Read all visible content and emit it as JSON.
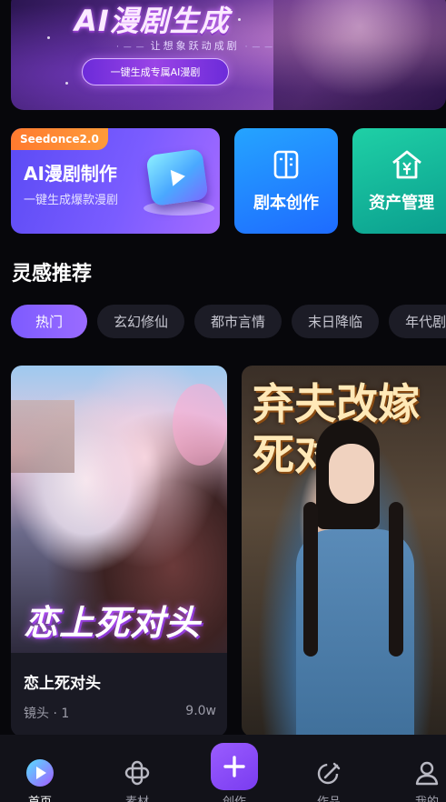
{
  "banner": {
    "title": "AI漫剧生成",
    "subtitle": "让想象跃动成剧",
    "cta_label": "一键生成专属AI漫剧"
  },
  "features": {
    "ai_card": {
      "tag": "Seedonce2.0",
      "title": "AI漫剧制作",
      "subtitle": "一键生成爆款漫剧",
      "icon": "play-icon"
    },
    "script_card": {
      "label": "剧本创作",
      "icon": "book-icon"
    },
    "assets_card": {
      "label": "资产管理",
      "icon": "house-yen-icon"
    }
  },
  "section": {
    "title": "灵感推荐"
  },
  "chips": [
    "热门",
    "玄幻修仙",
    "都市言情",
    "末日降临",
    "年代剧"
  ],
  "cards": [
    {
      "poster_title": "恋上死对头",
      "title": "恋上死对头",
      "meta": "镜头 · 1",
      "views": "9.0w"
    },
    {
      "poster_title_line1": "弃夫改嫁",
      "poster_title_line2": "死对头"
    }
  ],
  "nav": {
    "items": [
      {
        "label": "首页",
        "icon": "home-play-icon",
        "active": true
      },
      {
        "label": "素材",
        "icon": "material-icon",
        "active": false
      },
      {
        "label": "创作",
        "icon": "plus-icon",
        "active": false
      },
      {
        "label": "作品",
        "icon": "works-icon",
        "active": false
      },
      {
        "label": "我的",
        "icon": "profile-icon",
        "active": false
      }
    ]
  },
  "colors": {
    "accent": "#7d5bff",
    "seed_tag": "#ff7a2f",
    "script_card": "#1e6bff",
    "assets_card": "#0a9d8e"
  }
}
